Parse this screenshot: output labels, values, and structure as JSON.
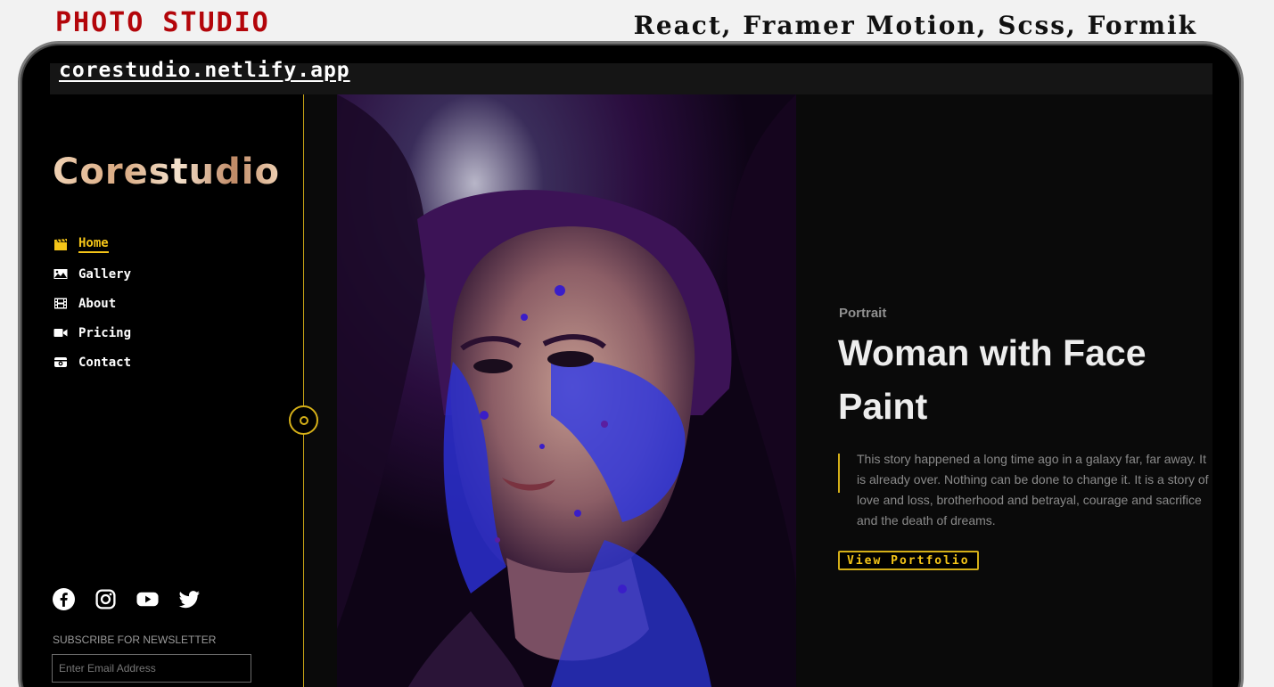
{
  "caption": {
    "title": "PHOTO STUDIO",
    "stack": "React, Framer Motion, Scss, Formik"
  },
  "browser": {
    "url": "corestudio.netlify.app"
  },
  "sidebar": {
    "logo": "Corestudio",
    "items": [
      {
        "label": "Home",
        "icon": "clapperboard-icon",
        "active": true
      },
      {
        "label": "Gallery",
        "icon": "image-icon",
        "active": false
      },
      {
        "label": "About",
        "icon": "film-icon",
        "active": false
      },
      {
        "label": "Pricing",
        "icon": "video-camera-icon",
        "active": false
      },
      {
        "label": "Contact",
        "icon": "camera-icon",
        "active": false
      }
    ],
    "social": [
      "facebook-icon",
      "instagram-icon",
      "youtube-icon",
      "twitter-icon"
    ],
    "newsletter_label": "SUBSCRIBE FOR NEWSLETTER",
    "email_placeholder": "Enter Email Address"
  },
  "hero": {
    "category": "Portrait",
    "title": "Woman with Face Paint",
    "description": "This story happened a long time ago in a galaxy far, far away. It is already over. Nothing can be done to change it. It is a story of love and loss, brotherhood and betrayal, courage and sacrifice and the death of dreams.",
    "cta": "View Portfolio"
  },
  "colors": {
    "accent": "#f5c518",
    "caption": "#b3050a",
    "background": "#0a0a0a"
  }
}
